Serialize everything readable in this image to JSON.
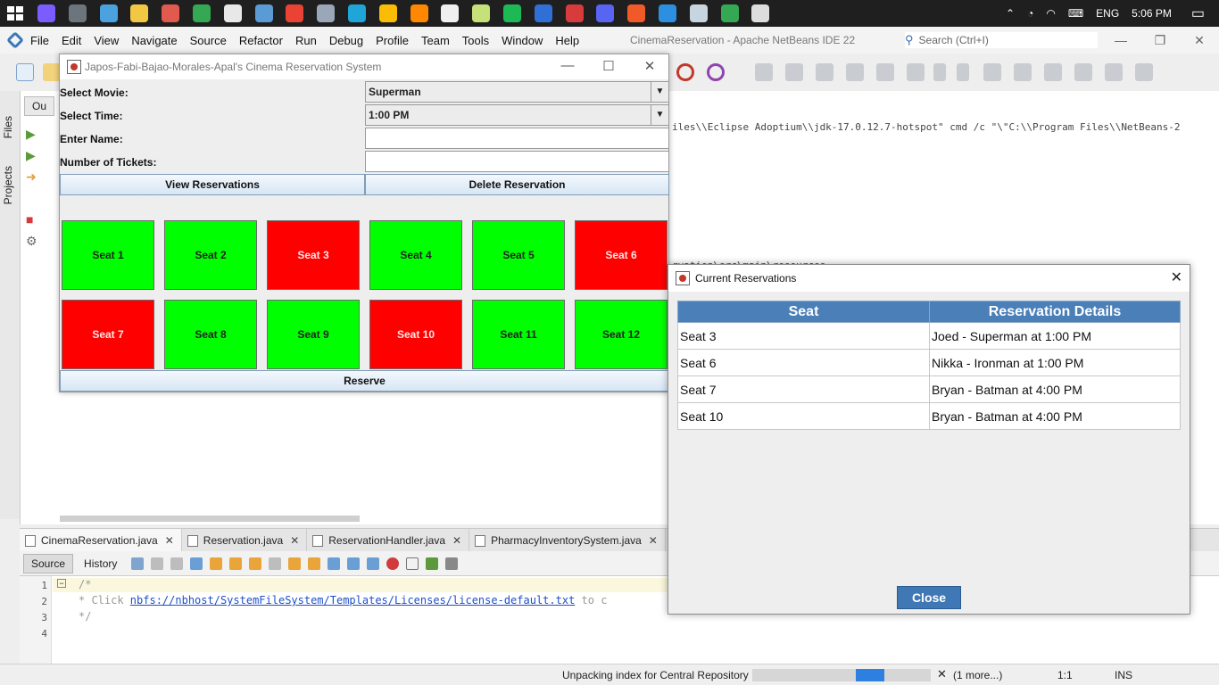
{
  "taskbar": {
    "app_icons": [
      {
        "name": "copilot-icon",
        "color": "#7b5cff"
      },
      {
        "name": "calculator-icon",
        "color": "#6c757d"
      },
      {
        "name": "app-icon",
        "color": "#4aa3df"
      },
      {
        "name": "file-explorer-icon",
        "color": "#f2c744"
      },
      {
        "name": "app-icon",
        "color": "#e05a4e"
      },
      {
        "name": "chrome-icon",
        "color": "#34a853"
      },
      {
        "name": "file-icon",
        "color": "#e8e8e8"
      },
      {
        "name": "notes-icon",
        "color": "#5a9bd5"
      },
      {
        "name": "chrome-icon",
        "color": "#ea4335"
      },
      {
        "name": "app-icon",
        "color": "#9aa7b8"
      },
      {
        "name": "edge-icon",
        "color": "#1fa5d8"
      },
      {
        "name": "chrome-icon",
        "color": "#fbbc05"
      },
      {
        "name": "vlc-icon",
        "color": "#ff8800"
      },
      {
        "name": "github-icon",
        "color": "#f0f0f0"
      },
      {
        "name": "app-icon",
        "color": "#c6e07a"
      },
      {
        "name": "spotify-icon",
        "color": "#1db954"
      },
      {
        "name": "app-icon",
        "color": "#2f6fd6"
      },
      {
        "name": "app-icon",
        "color": "#d83b3b"
      },
      {
        "name": "discord-icon",
        "color": "#5865f2"
      },
      {
        "name": "app-icon",
        "color": "#f05a28"
      },
      {
        "name": "vscode-icon",
        "color": "#2c8fe0"
      },
      {
        "name": "steam-icon",
        "color": "#c7d5e0"
      },
      {
        "name": "chrome-icon",
        "color": "#34a853"
      },
      {
        "name": "app-icon",
        "color": "#dddddd"
      }
    ],
    "language": "ENG",
    "time": "5:06 PM"
  },
  "ide": {
    "title": "CinemaReservation - Apache NetBeans IDE 22",
    "menus": [
      "File",
      "Edit",
      "View",
      "Navigate",
      "Source",
      "Refactor",
      "Run",
      "Debug",
      "Profile",
      "Team",
      "Tools",
      "Window",
      "Help"
    ],
    "search_placeholder": "Search (Ctrl+I)",
    "side_tabs": [
      "Files",
      "Projects"
    ],
    "output_tab": "Ou",
    "console_line1": "iles\\\\Eclipse Adoptium\\\\jdk-17.0.12.7-hotspot\" cmd /c \"\\\"C:\\\\Program Files\\\\NetBeans-2",
    "console_line2": "rvation\\src\\main\\resources",
    "editor_tabs": [
      {
        "label": "CinemaReservation.java",
        "active": true
      },
      {
        "label": "Reservation.java",
        "active": false
      },
      {
        "label": "ReservationHandler.java",
        "active": false
      },
      {
        "label": "PharmacyInventorySystem.java",
        "active": false
      }
    ],
    "source_label": "Source",
    "history_label": "History",
    "line_numbers": [
      "1",
      "2",
      "3",
      "4"
    ],
    "code_line1": "/*",
    "code_line2_prefix": " * Click ",
    "code_line2_link": "nbfs://nbhost/SystemFileSystem/Templates/Licenses/license-default.txt",
    "code_line2_suffix": " to c",
    "code_line3": " */",
    "status_text": "Unpacking index for Central Repository",
    "status_progress": 0.16,
    "status_more": "(1 more...)",
    "status_position": "1:1",
    "status_mode": "INS"
  },
  "cinema": {
    "title": "Japos-Fabi-Bajao-Morales-Apal's Cinema Reservation System",
    "select_movie_label": "Select Movie:",
    "select_movie_value": "Superman",
    "select_time_label": "Select Time:",
    "select_time_value": "1:00 PM",
    "enter_name_label": "Enter Name:",
    "enter_name_value": "",
    "tickets_label": "Number of Tickets:",
    "tickets_value": "",
    "view_button": "View Reservations",
    "delete_button": "Delete Reservation",
    "reserve_button": "Reserve",
    "seats": [
      {
        "label": "Seat 1",
        "reserved": false
      },
      {
        "label": "Seat 2",
        "reserved": false
      },
      {
        "label": "Seat 3",
        "reserved": true
      },
      {
        "label": "Seat 4",
        "reserved": false
      },
      {
        "label": "Seat 5",
        "reserved": false
      },
      {
        "label": "Seat 6",
        "reserved": true
      },
      {
        "label": "Seat 7",
        "reserved": true
      },
      {
        "label": "Seat 8",
        "reserved": false
      },
      {
        "label": "Seat 9",
        "reserved": false
      },
      {
        "label": "Seat 10",
        "reserved": true
      },
      {
        "label": "Seat 11",
        "reserved": false
      },
      {
        "label": "Seat 12",
        "reserved": false
      }
    ],
    "colors": {
      "available": "#00ff00",
      "reserved": "#ff0000"
    }
  },
  "reservations_dialog": {
    "title": "Current Reservations",
    "headers": [
      "Seat",
      "Reservation Details"
    ],
    "rows": [
      [
        "Seat 3",
        "Joed - Superman at 1:00 PM"
      ],
      [
        "Seat 6",
        "Nikka - Ironman at 1:00 PM"
      ],
      [
        "Seat 7",
        "Bryan - Batman at 4:00 PM"
      ],
      [
        "Seat 10",
        "Bryan - Batman at 4:00 PM"
      ]
    ],
    "close_button": "Close",
    "header_color": "#4a7fb8"
  }
}
